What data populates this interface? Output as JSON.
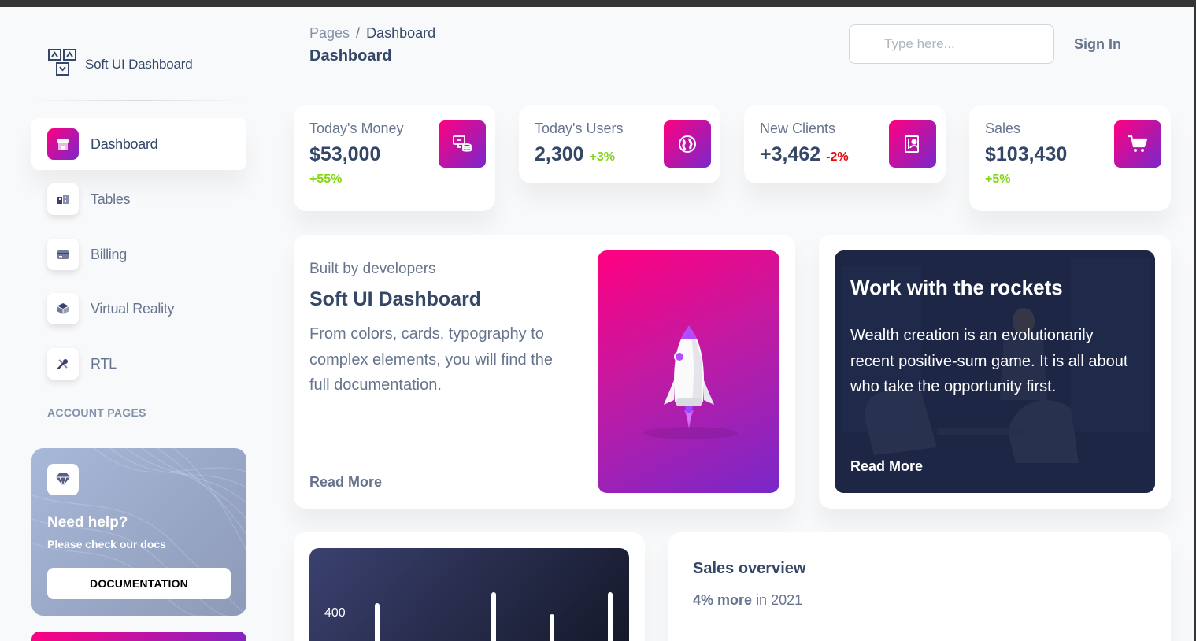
{
  "brand": {
    "name": "Soft UI Dashboard"
  },
  "sidebar": {
    "items": [
      {
        "label": "Dashboard",
        "icon": "shop-icon",
        "active": true
      },
      {
        "label": "Tables",
        "icon": "office-icon",
        "active": false
      },
      {
        "label": "Billing",
        "icon": "credit-card-icon",
        "active": false
      },
      {
        "label": "Virtual Reality",
        "icon": "box-3d-icon",
        "active": false
      },
      {
        "label": "RTL",
        "icon": "settings-tools-icon",
        "active": false
      }
    ],
    "section_title": "ACCOUNT PAGES",
    "help": {
      "title": "Need help?",
      "subtitle": "Please check our docs",
      "button": "DOCUMENTATION",
      "icon": "diamond-icon"
    }
  },
  "header": {
    "breadcrumb": {
      "root": "Pages",
      "separator": "/",
      "current": "Dashboard"
    },
    "title": "Dashboard",
    "search_placeholder": "Type here...",
    "sign_in": "Sign In"
  },
  "stats": [
    {
      "label": "Today's Money",
      "value": "$53,000",
      "change": "+55%",
      "direction": "up",
      "icon": "money-coins-icon"
    },
    {
      "label": "Today's Users",
      "value": "2,300",
      "change": "+3%",
      "direction": "up",
      "icon": "world-icon"
    },
    {
      "label": "New Clients",
      "value": "+3,462",
      "change": "-2%",
      "direction": "down",
      "icon": "paper-diploma-icon"
    },
    {
      "label": "Sales",
      "value": "$103,430",
      "change": "+5%",
      "direction": "up",
      "icon": "cart-icon"
    }
  ],
  "info_card": {
    "overline": "Built by developers",
    "title": "Soft UI Dashboard",
    "description": "From colors, cards, typography to complex elements, you will find the full documentation.",
    "link": "Read More"
  },
  "rockets_card": {
    "title": "Work with the rockets",
    "description": "Wealth creation is an evolutionarily recent positive-sum game. It is all about who take the opportunity first.",
    "link": "Read More"
  },
  "bar_chart": {
    "y_tick": "400"
  },
  "sales_overview": {
    "title": "Sales overview",
    "highlight": "4% more",
    "suffix": "in 2021"
  },
  "colors": {
    "accent_start": "#7928ca",
    "accent_end": "#ff0080",
    "success": "#82d616",
    "danger": "#ea0606",
    "text": "#344767",
    "muted": "#67748e"
  }
}
